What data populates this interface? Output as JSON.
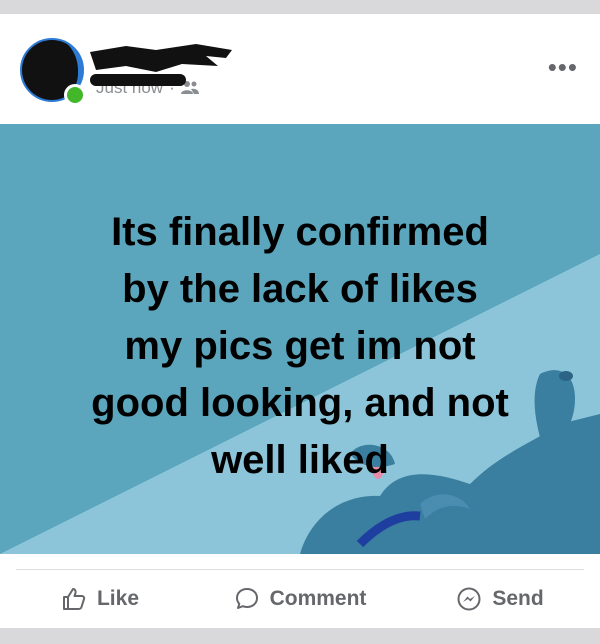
{
  "post": {
    "timestamp": "Just now",
    "audience_icon": "friends-icon",
    "more_icon": "more-horizontal-icon",
    "more_label": "•••"
  },
  "banner": {
    "lines": [
      "Its finally confirmed",
      "by the lack of likes",
      "my pics get im not",
      "good looking, and not",
      "well liked"
    ],
    "background_color": "#5ba6bd",
    "accent_color": "#8cc5d9"
  },
  "actions": {
    "like_label": "Like",
    "comment_label": "Comment",
    "send_label": "Send"
  },
  "colors": {
    "muted_text": "#65676b",
    "online": "#42b72a",
    "brand": "#2e7bd6"
  }
}
